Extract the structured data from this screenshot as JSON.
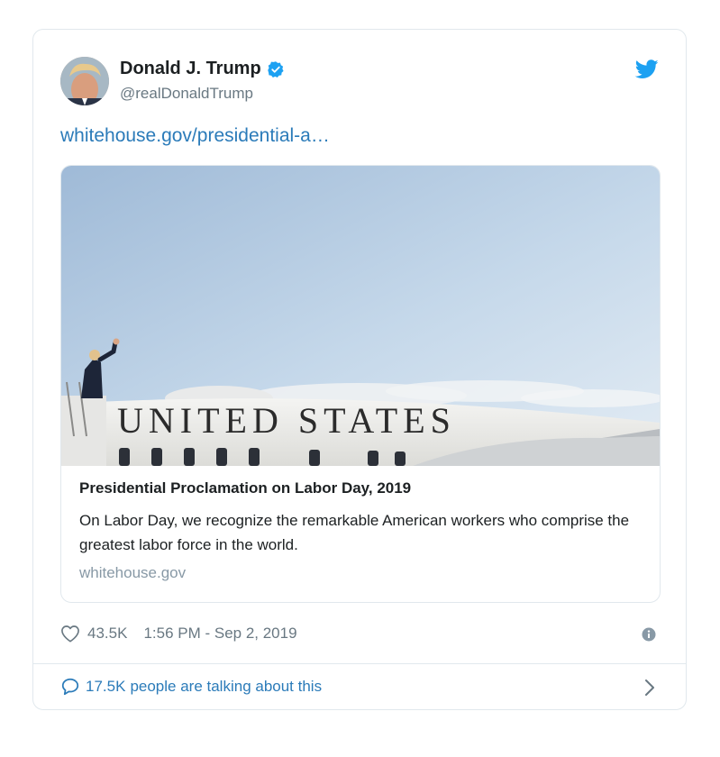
{
  "author": {
    "name": "Donald J. Trump",
    "handle": "@realDonaldTrump",
    "verified": true
  },
  "tweet": {
    "link_text": "whitehouse.gov/presidential-a…"
  },
  "card": {
    "title": "Presidential Proclamation on Labor Day, 2019",
    "description": "On Labor Day, we recognize the remarkable American workers who comprise the greatest labor force in the world.",
    "domain": "whitehouse.gov",
    "image_text": "UNITED STATES"
  },
  "meta": {
    "likes": "43.5K",
    "timestamp": "1:56 PM - Sep 2, 2019"
  },
  "footer": {
    "talking_count": "17.5K",
    "talking_label": "people are talking about this"
  },
  "icons": {
    "brand": "twitter-bird-icon",
    "verified": "verified-badge-icon",
    "like": "heart-icon",
    "info": "info-icon",
    "reply": "speech-bubble-icon",
    "next": "chevron-right-icon"
  },
  "colors": {
    "link": "#2b7bb9",
    "twitter_blue": "#1da1f2",
    "muted": "#697882",
    "border": "#e1e8ed"
  }
}
